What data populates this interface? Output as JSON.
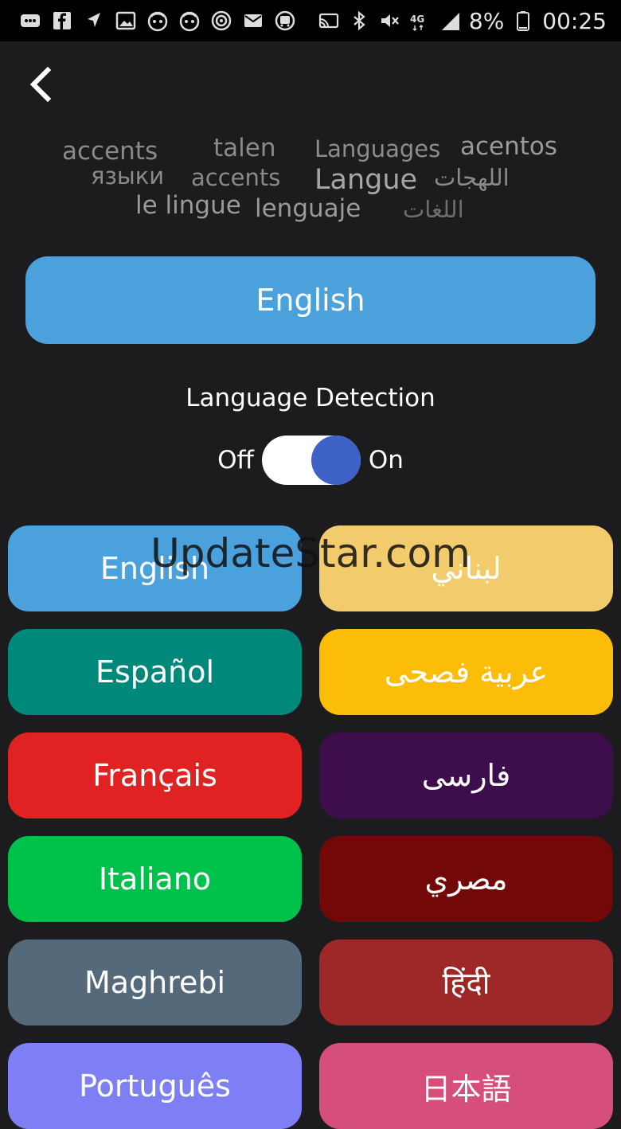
{
  "status_bar": {
    "left_icons": [
      "messages-icon",
      "facebook-icon",
      "navigation-icon",
      "gallery-icon",
      "avatar-app-icon",
      "avatar-app-icon-2",
      "sync-icon",
      "mail-icon",
      "bus-icon"
    ],
    "right_icons": [
      "cast-icon",
      "bluetooth-icon",
      "mute-icon",
      "network-4g-icon",
      "signal-icon"
    ],
    "battery": "8%",
    "time": "00:25"
  },
  "word_cloud": [
    {
      "text": "accents",
      "color": "#8a8a8a"
    },
    {
      "text": "talen",
      "color": "#8a8a8a"
    },
    {
      "text": "Languages",
      "color": "#8c8c8c"
    },
    {
      "text": "acentos",
      "color": "#9a9a9a"
    },
    {
      "text": "языки",
      "color": "#8a8a8a"
    },
    {
      "text": "accents",
      "color": "#8a8a8a"
    },
    {
      "text": "Langue",
      "color": "#a6a6a6"
    },
    {
      "text": "اللهجات",
      "color": "#8a8a8a"
    },
    {
      "text": "le lingue",
      "color": "#9a9a9a"
    },
    {
      "text": "lenguaje",
      "color": "#9a9a9a"
    },
    {
      "text": "اللغات",
      "color": "#6e6e6e"
    }
  ],
  "selected_language": "English",
  "detection": {
    "title": "Language Detection",
    "off": "Off",
    "on": "On"
  },
  "languages": [
    {
      "label": "English",
      "color": "#4aa1dc"
    },
    {
      "label": "لبناني",
      "color": "#f2cc6c"
    },
    {
      "label": "Español",
      "color": "#00897b"
    },
    {
      "label": "عربية فصحى",
      "color": "#fbbd08"
    },
    {
      "label": "Français",
      "color": "#e02222"
    },
    {
      "label": "فارسى",
      "color": "#3e0e4c"
    },
    {
      "label": "Italiano",
      "color": "#00c14a"
    },
    {
      "label": "مصري",
      "color": "#730808"
    },
    {
      "label": "Maghrebi",
      "color": "#546a7b"
    },
    {
      "label": "हिंदी",
      "color": "#9e2727"
    },
    {
      "label": "Português",
      "color": "#7f7ff5"
    },
    {
      "label": "日本語",
      "color": "#d64e7a"
    }
  ],
  "watermark": "UpdateStar.com"
}
